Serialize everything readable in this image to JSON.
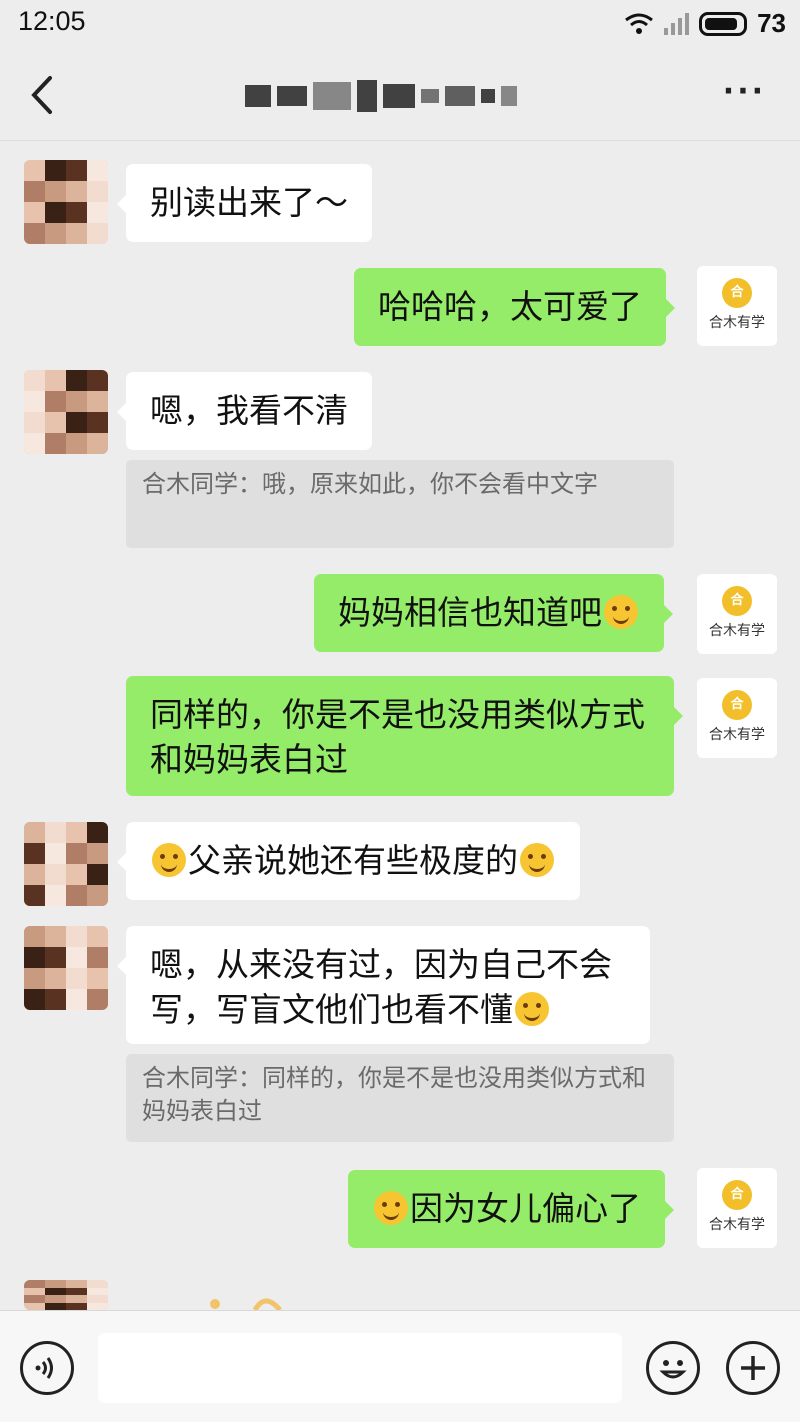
{
  "status_bar": {
    "time": "12:05",
    "battery": "73"
  },
  "brand_avatar": {
    "label": "合木有学",
    "logo_text": "合"
  },
  "messages": [
    {
      "side": "left",
      "text": "别读出来了～"
    },
    {
      "side": "right",
      "text": "哈哈哈，太可爱了"
    },
    {
      "side": "left",
      "text": "嗯，我看不清",
      "quote": "合木同学：哦，原来如此，你不会看中文字"
    },
    {
      "side": "right",
      "text": "妈妈相信也知道吧",
      "emoji_after": "grin"
    },
    {
      "side": "right",
      "lines": [
        "同样的，你是不是也没用类似方式",
        "和妈妈表白过"
      ]
    },
    {
      "side": "left",
      "text": "父亲说她还有些极度的",
      "emoji_before": "laugh-tears",
      "emoji_after": "grin"
    },
    {
      "side": "left",
      "lines": [
        "嗯，从来没有过，因为自己不会",
        "写，写盲文他们也看不懂"
      ],
      "emoji_after": "laugh-tears",
      "quote": "合木同学：同样的，你是不是也没用类似方式和妈妈表白过"
    },
    {
      "side": "right",
      "text": "因为女儿偏心了",
      "emoji_before": "grin"
    }
  ],
  "colors": {
    "background": "#ededed",
    "right_bubble": "#95ec69",
    "left_bubble": "#ffffff",
    "brand_logo": "#f2bf2a"
  }
}
